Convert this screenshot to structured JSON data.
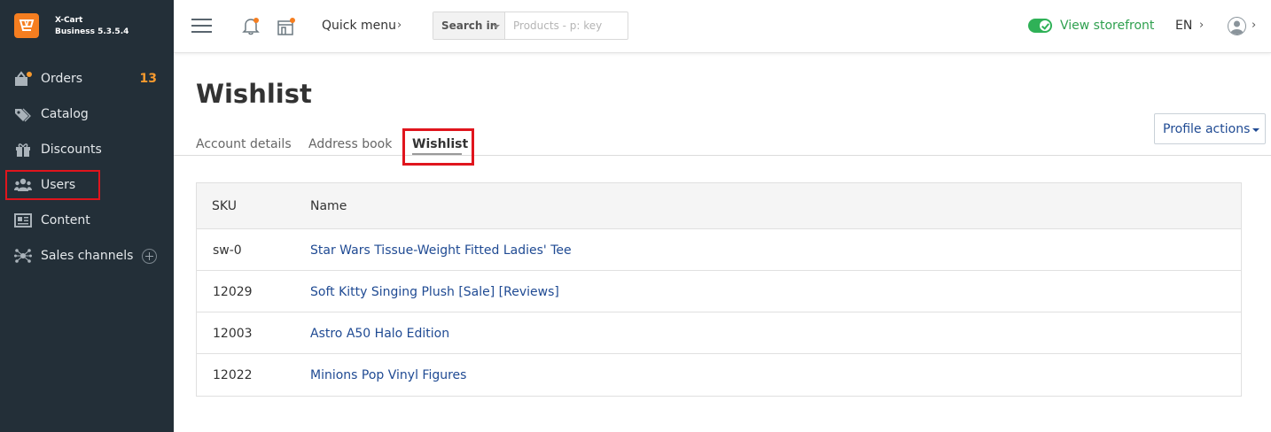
{
  "brand": {
    "name": "X-Cart",
    "version": "Business 5.3.5.4"
  },
  "sidebar": {
    "items": [
      {
        "label": "Orders",
        "count": "13"
      },
      {
        "label": "Catalog"
      },
      {
        "label": "Discounts"
      },
      {
        "label": "Users"
      },
      {
        "label": "Content"
      },
      {
        "label": "Sales channels"
      }
    ]
  },
  "header": {
    "quick_menu": "Quick menu",
    "chevron": "›",
    "search": {
      "scope_label": "Search in",
      "placeholder": "Products - p: key"
    },
    "storefront_label": "View storefront",
    "language": "EN"
  },
  "page": {
    "title": "Wishlist",
    "tabs": [
      {
        "label": "Account details"
      },
      {
        "label": "Address book"
      },
      {
        "label": "Wishlist",
        "active": true
      }
    ],
    "profile_actions": "Profile actions"
  },
  "table": {
    "columns": [
      "SKU",
      "Name"
    ],
    "rows": [
      {
        "sku": "sw-0",
        "name": "Star Wars Tissue-Weight Fitted Ladies' Tee"
      },
      {
        "sku": "12029",
        "name": "Soft Kitty Singing Plush [Sale] [Reviews]"
      },
      {
        "sku": "12003",
        "name": "Astro A50 Halo Edition"
      },
      {
        "sku": "12022",
        "name": "Minions Pop Vinyl Figures"
      }
    ]
  },
  "colors": {
    "sidebar_bg": "#232f38",
    "accent_orange": "#f57e20",
    "link_blue": "#1f4a93",
    "storefront_green": "#2fa04f",
    "highlight_red": "#e0151d"
  }
}
